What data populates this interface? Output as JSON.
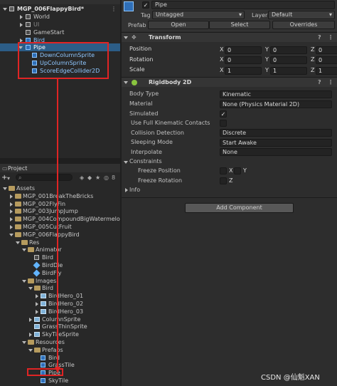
{
  "hierarchy": {
    "scene_name": "MGP_006FlappyBird*",
    "items": [
      {
        "label": "World",
        "type": "cube",
        "expanded": false
      },
      {
        "label": "UI",
        "type": "cube",
        "expanded": false
      },
      {
        "label": "GameStart",
        "type": "cube",
        "expanded": false
      },
      {
        "label": "Bird",
        "type": "cube-blue",
        "expanded": false
      },
      {
        "label": "Pipe",
        "type": "cube-blue",
        "selected": true
      },
      {
        "label": "DownColumnSprite",
        "type": "cube-blue"
      },
      {
        "label": "UpColumnSprite",
        "type": "cube-blue"
      },
      {
        "label": "ScoreEdgeCollider2D",
        "type": "cube-blue"
      }
    ]
  },
  "project": {
    "tab_label": "Project",
    "search_placeholder": "",
    "badge_count": "8",
    "tree": [
      {
        "label": "Assets",
        "depth": 0,
        "icon": "folder",
        "open": true
      },
      {
        "label": "MGP_001BreakTheBricks",
        "depth": 1,
        "icon": "folder"
      },
      {
        "label": "MGP_002FlyFin",
        "depth": 1,
        "icon": "folder"
      },
      {
        "label": "MGP_003JumpJump",
        "depth": 1,
        "icon": "folder"
      },
      {
        "label": "MGP_004CompoundBigWatermelon",
        "depth": 1,
        "icon": "folder"
      },
      {
        "label": "MGP_005CutFruit",
        "depth": 1,
        "icon": "folder"
      },
      {
        "label": "MGP_006FlappyBird",
        "depth": 1,
        "icon": "folder",
        "open": true
      },
      {
        "label": "Res",
        "depth": 2,
        "icon": "folder",
        "open": true
      },
      {
        "label": "Animator",
        "depth": 3,
        "icon": "folder",
        "open": true
      },
      {
        "label": "Bird",
        "depth": 4,
        "icon": "animator"
      },
      {
        "label": "BirdDie",
        "depth": 4,
        "icon": "anim"
      },
      {
        "label": "BirdFly",
        "depth": 4,
        "icon": "anim"
      },
      {
        "label": "Images",
        "depth": 3,
        "icon": "folder",
        "open": true
      },
      {
        "label": "Bird",
        "depth": 4,
        "icon": "folder",
        "open": true
      },
      {
        "label": "BirdHero_01",
        "depth": 5,
        "icon": "sprite",
        "arrow": true
      },
      {
        "label": "BirdHero_02",
        "depth": 5,
        "icon": "sprite",
        "arrow": true
      },
      {
        "label": "BirdHero_03",
        "depth": 5,
        "icon": "sprite",
        "arrow": true
      },
      {
        "label": "ColumnSprite",
        "depth": 4,
        "icon": "sprite",
        "arrow": true
      },
      {
        "label": "GrassThinSprite",
        "depth": 4,
        "icon": "sprite"
      },
      {
        "label": "SkyTileSprite",
        "depth": 4,
        "icon": "sprite",
        "arrow": true
      },
      {
        "label": "Resources",
        "depth": 3,
        "icon": "folder",
        "open": true
      },
      {
        "label": "Prefabs",
        "depth": 4,
        "icon": "folder",
        "open": true
      },
      {
        "label": "Bird",
        "depth": 5,
        "icon": "prefab"
      },
      {
        "label": "GrassTile",
        "depth": 5,
        "icon": "prefab"
      },
      {
        "label": "Pipe",
        "depth": 5,
        "icon": "prefab"
      },
      {
        "label": "SkyTile",
        "depth": 5,
        "icon": "prefab"
      }
    ]
  },
  "inspector": {
    "object_name": "Pipe",
    "tag_label": "Tag",
    "tag_value": "Untagged",
    "layer_label": "Layer",
    "layer_value": "Default",
    "prefab_label": "Prefab",
    "open_label": "Open",
    "select_label": "Select",
    "overrides_label": "Overrides",
    "transform": {
      "title": "Transform",
      "position_label": "Position",
      "rotation_label": "Rotation",
      "scale_label": "Scale",
      "position": [
        "0",
        "0",
        "0"
      ],
      "rotation": [
        "0",
        "0",
        "0"
      ],
      "scale": [
        "1",
        "1",
        "1"
      ]
    },
    "rigidbody": {
      "title": "Rigidbody 2D",
      "body_type_label": "Body Type",
      "body_type_value": "Kinematic",
      "material_label": "Material",
      "material_value": "None (Physics Material 2D)",
      "simulated_label": "Simulated",
      "full_kinematic_label": "Use Full Kinematic Contacts",
      "collision_label": "Collision Detection",
      "collision_value": "Discrete",
      "sleeping_label": "Sleeping Mode",
      "sleeping_value": "Start Awake",
      "interpolate_label": "Interpolate",
      "interpolate_value": "None",
      "constraints_label": "Constraints",
      "freeze_pos_label": "Freeze Position",
      "freeze_rot_label": "Freeze Rotation",
      "info_label": "Info"
    },
    "add_component_label": "Add Component"
  },
  "watermark": "CSDN @仙魁XAN",
  "colors": {
    "highlight": "#e02424",
    "selection": "#2c5d87",
    "prefab_blue": "#8fc7ff"
  }
}
